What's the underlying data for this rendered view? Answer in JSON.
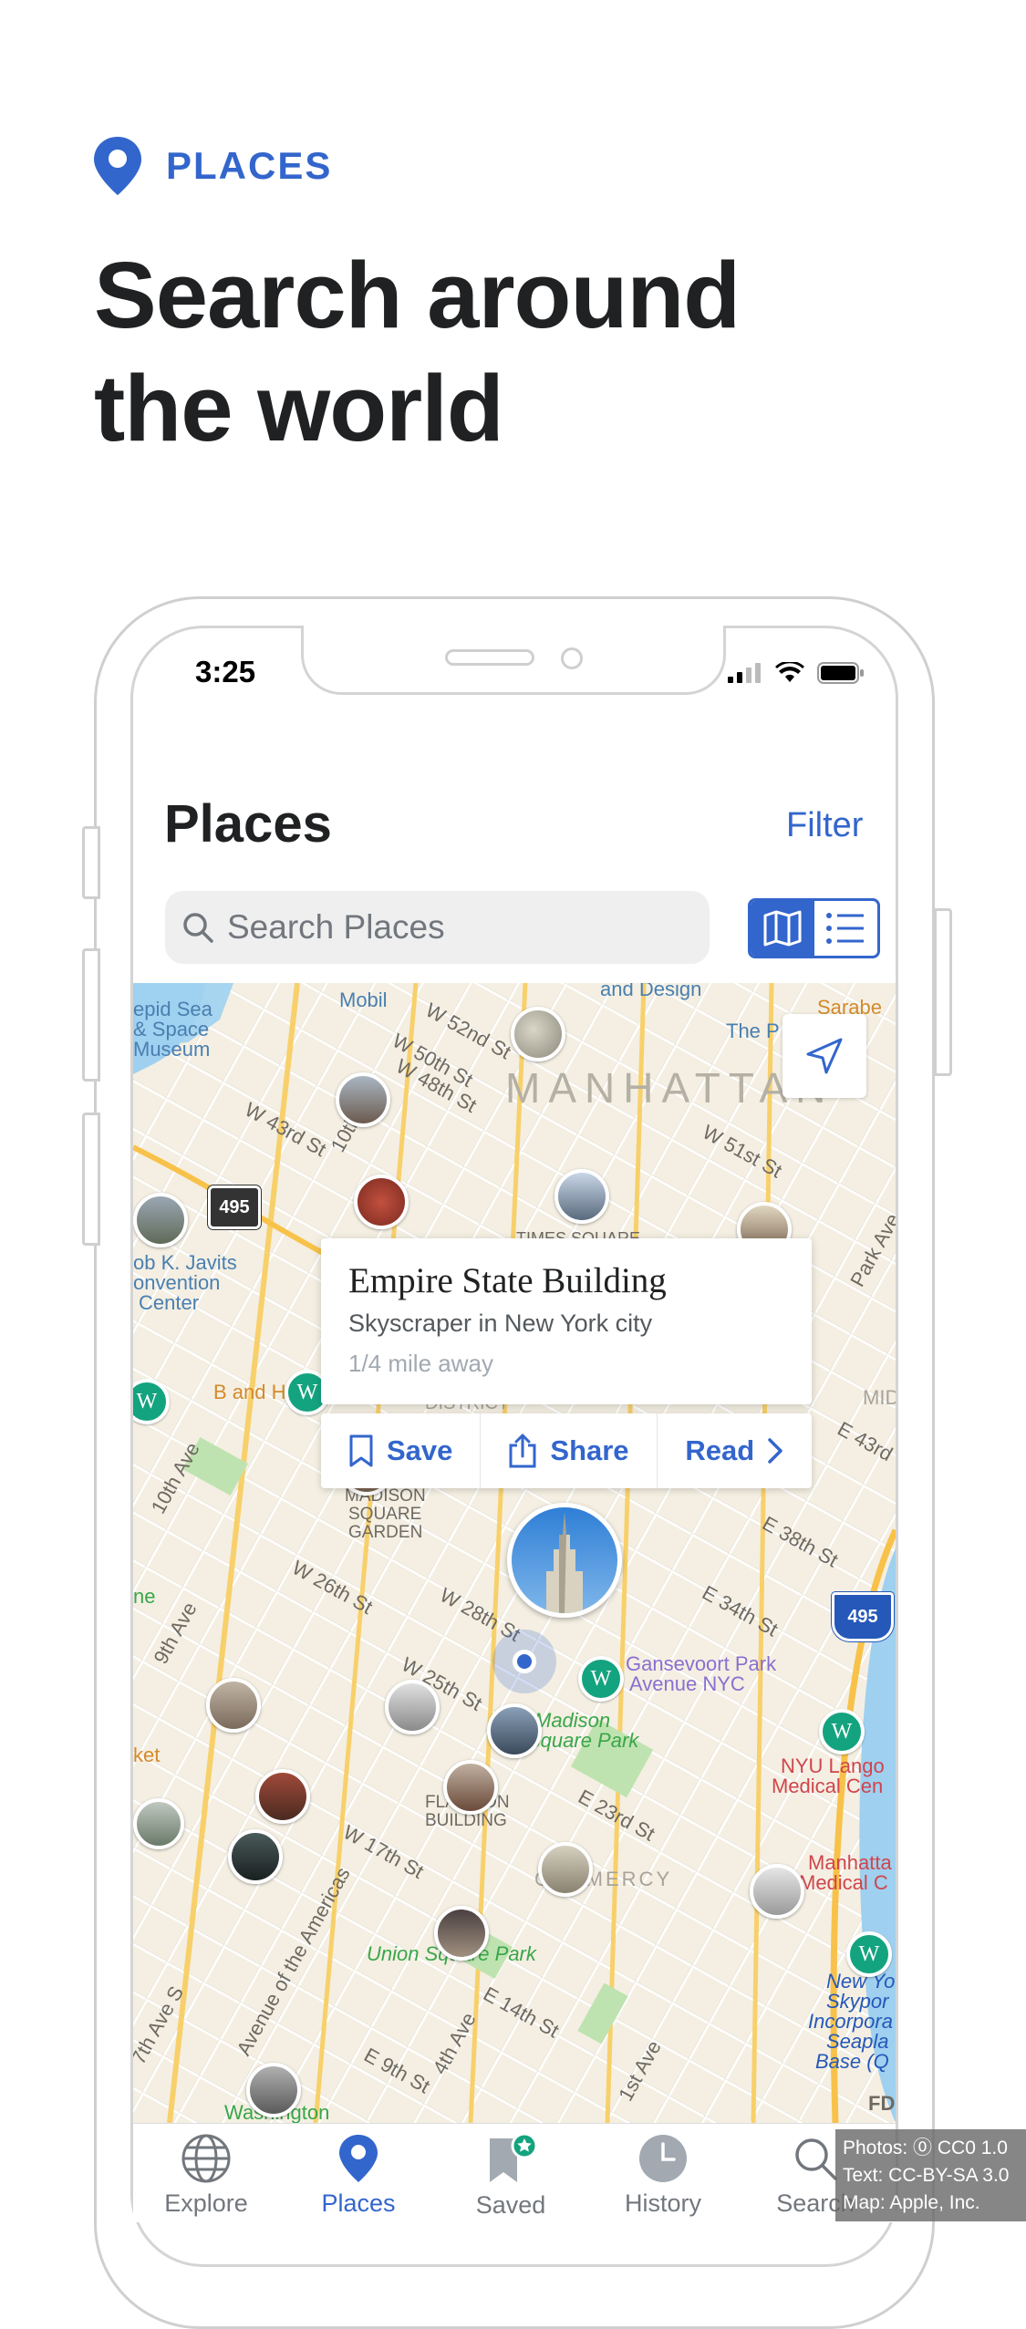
{
  "hero": {
    "eyebrow": "PLACES",
    "title_line1": "Search around",
    "title_line2": "the world"
  },
  "status_bar": {
    "time": "3:25"
  },
  "nav": {
    "title": "Places",
    "filter_label": "Filter"
  },
  "search": {
    "placeholder": "Search Places"
  },
  "map": {
    "labels": {
      "intrepid": "epid Sea",
      "intrepid2": "& Space",
      "intrepid3": "Museum",
      "mobil": "Mobil",
      "design": "and Design",
      "thep": "The P",
      "sarabe": "Sarabe",
      "manhattan": "MANHATTAN",
      "w52": "W 52nd St",
      "w50": "W 50th St",
      "w48": "W 48th St",
      "w43": "W 43rd St",
      "w51": "W 51st St",
      "tenth": "10th",
      "route495": "495",
      "javits1": "ob K. Javits",
      "javits2": "onvention",
      "javits3": "Center",
      "times": "TIMES SQUARE",
      "parkave": "Park Ave",
      "district": "DISTRICT",
      "bandh": "B and H",
      "midtown": "MIDTO",
      "e43": "E 43rd",
      "tenthave": "10th Ave",
      "msg1": "MADISON",
      "msg2": "SQUARE",
      "msg3": "GARDEN",
      "e38": "E 38th St",
      "e34": "E 34th St",
      "ine": "ne",
      "ninthave": "9th Ave",
      "w26": "W 26th St",
      "w28": "W 28th St",
      "w25": "W 25th St",
      "i495": "495",
      "gansevoort1": "Gansevoort Park",
      "gansevoort2": "Avenue NYC",
      "madison1": "Madison",
      "madison2": "Square Park",
      "nyu1": "NYU Lango",
      "nyu2": "Medical Cen",
      "ket": "ket",
      "flatiron1": "FLATIRON",
      "flatiron2": "BUILDING",
      "e23": "E 23rd St",
      "w17": "W 17th St",
      "gramercy": "GRAMERCY",
      "manmed1": "Manhatta",
      "manmed2": "Medical C",
      "aveamericas": "Avenue of the Americas",
      "seventhave": "7th Ave S",
      "union": "Union Square Park",
      "e14": "E 14th St",
      "fourthave": "4th Ave",
      "e9": "E 9th St",
      "firstave": "1st Ave",
      "washington": "Washington",
      "newyork1": "New Yo",
      "newyork2": "Skypor",
      "newyork3": "Incorpora",
      "newyork4": "Seapla",
      "newyork5": "Base (Q",
      "fdr": "FD"
    }
  },
  "card": {
    "title": "Empire State Building",
    "subtitle": "Skyscraper in New York city",
    "distance": "1/4 mile away",
    "save": "Save",
    "share": "Share",
    "read": "Read"
  },
  "tabs": [
    {
      "label": "Explore",
      "icon": "globe-icon"
    },
    {
      "label": "Places",
      "icon": "map-pin-icon"
    },
    {
      "label": "Saved",
      "icon": "bookmark-star-icon"
    },
    {
      "label": "History",
      "icon": "clock-icon"
    },
    {
      "label": "Search",
      "icon": "search-icon"
    }
  ],
  "credits": {
    "photos": "Photos: ⓪ CC0 1.0",
    "text": "Text: CC-BY-SA 3.0",
    "map": "Map:     Apple, Inc."
  },
  "colors": {
    "accent": "#3366cc",
    "wiki_pin": "#14a37f",
    "map_bg": "#f4efe2"
  }
}
